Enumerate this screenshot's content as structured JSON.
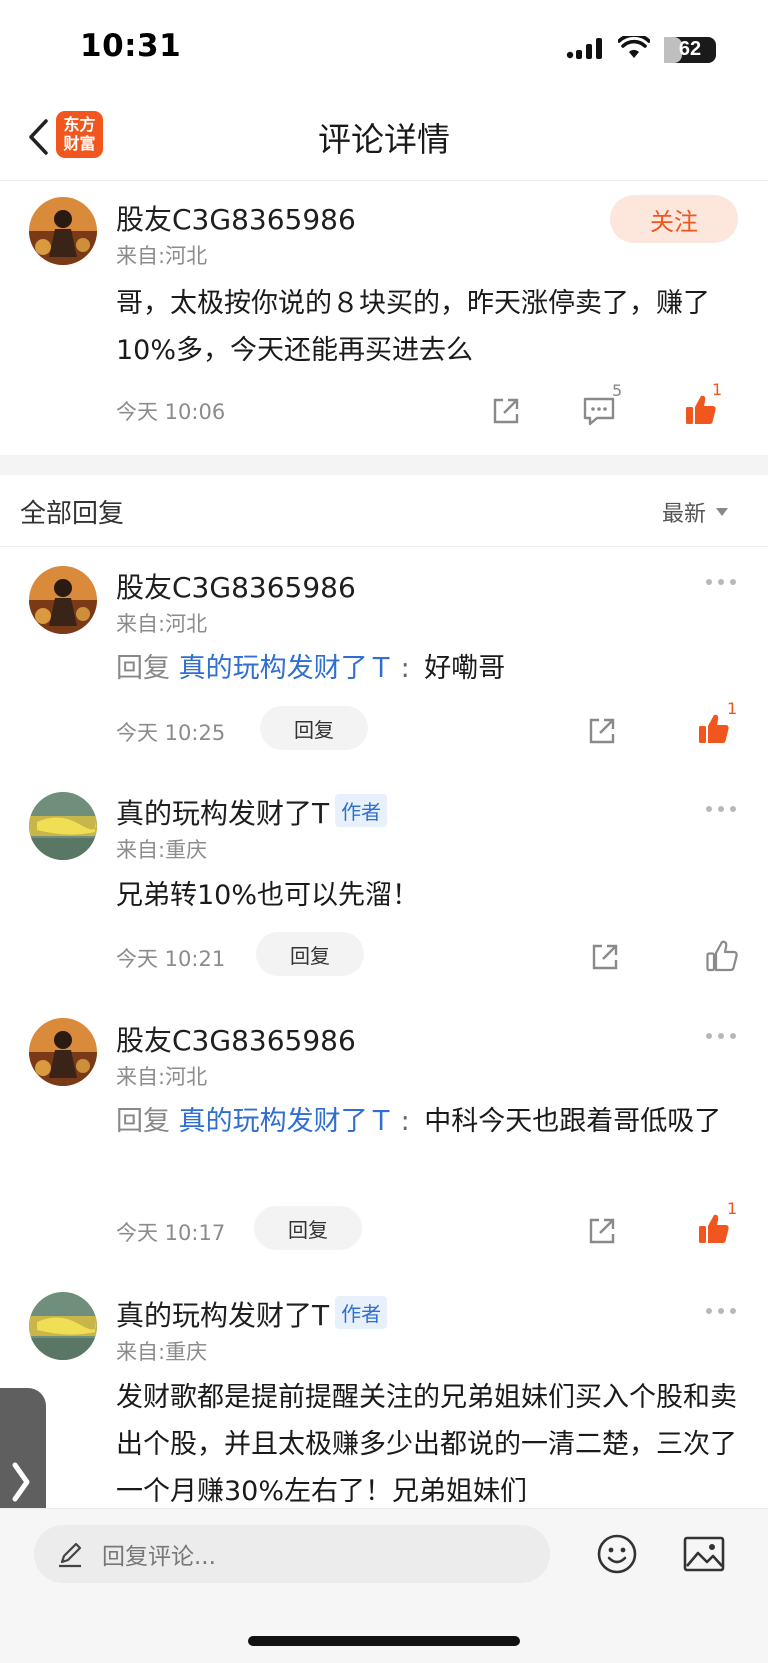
{
  "status_bar": {
    "time": "10:31",
    "battery": "62"
  },
  "header": {
    "title": "评论详情",
    "logo_line1": "东方",
    "logo_line2": "财富"
  },
  "main_comment": {
    "author": "股友C3G8365986",
    "location": "来自:河北",
    "follow_label": "关注",
    "text": "哥，太极按你说的８块买的，昨天涨停卖了，赚了10%多，今天还能再买进去么",
    "time": "今天 10:06",
    "comment_count": "5",
    "like_count": "1"
  },
  "replies_section": {
    "title": "全部回复",
    "sort_label": "最新"
  },
  "replies": [
    {
      "author": "股友C3G8365986",
      "location": "来自:河北",
      "reply_prefix": "回复",
      "mention": "真的玩构发财了Ｔ",
      "text": "好嘞哥",
      "time": "今天 10:25",
      "reply_label": "回复",
      "like_count": "1"
    },
    {
      "author": "真的玩构发财了T",
      "badge": "作者",
      "location": "来自:重庆",
      "text": "兄弟转10%也可以先溜！",
      "time": "今天 10:21",
      "reply_label": "回复"
    },
    {
      "author": "股友C3G8365986",
      "location": "来自:河北",
      "reply_prefix": "回复",
      "mention": "真的玩构发财了Ｔ",
      "text": "中科今天也跟着哥低吸了",
      "time": "今天 10:17",
      "reply_label": "回复",
      "like_count": "1"
    },
    {
      "author": "真的玩构发财了T",
      "badge": "作者",
      "location": "来自:重庆",
      "text": "发财歌都是提前提醒关注的兄弟姐妹们买入个股和卖出个股，并且太极赚多少出都说的一清二楚，三次了一个月赚30%左右了！兄弟姐妹们"
    }
  ],
  "bottom_bar": {
    "reply_placeholder": "回复评论..."
  },
  "colors": {
    "accent": "#f0561d",
    "link": "#2f6fd1",
    "badge_bg": "#e8f0fb"
  }
}
